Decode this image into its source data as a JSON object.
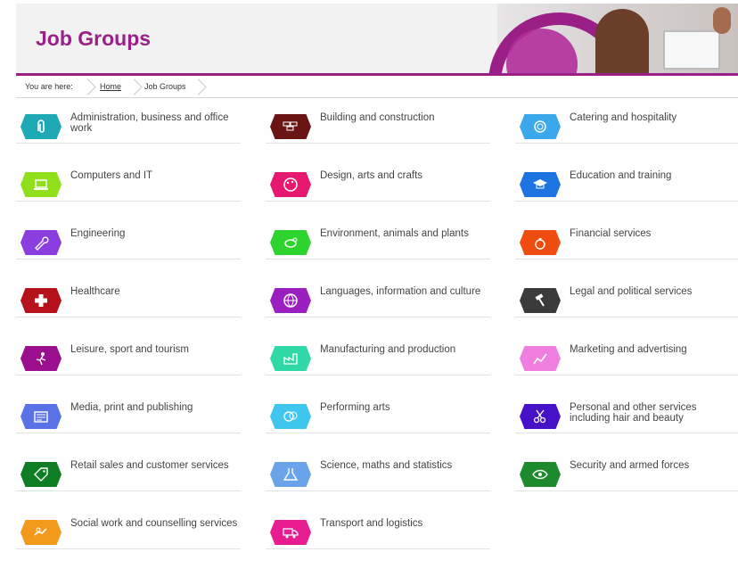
{
  "header": {
    "title": "Job Groups"
  },
  "breadcrumb": {
    "prefix": "You are here:",
    "home": "Home",
    "current": "Job Groups"
  },
  "groups": [
    {
      "label": "Administration, business and office work",
      "color": "#1ea9b4",
      "icon": "paperclip-icon"
    },
    {
      "label": "Building and construction",
      "color": "#6b1414",
      "icon": "bricks-icon"
    },
    {
      "label": "Catering and hospitality",
      "color": "#3aa8ea",
      "icon": "plate-icon"
    },
    {
      "label": "Computers and IT",
      "color": "#8fe01a",
      "icon": "laptop-icon"
    },
    {
      "label": "Design, arts and crafts",
      "color": "#e6186f",
      "icon": "palette-icon"
    },
    {
      "label": "Education and training",
      "color": "#1d74e0",
      "icon": "mortarboard-icon"
    },
    {
      "label": "Engineering",
      "color": "#8a3ee0",
      "icon": "wrench-icon"
    },
    {
      "label": "Environment, animals and plants",
      "color": "#2fd32f",
      "icon": "animal-icon"
    },
    {
      "label": "Financial services",
      "color": "#ef4d10",
      "icon": "money-bag-icon"
    },
    {
      "label": "Healthcare",
      "color": "#b5121b",
      "icon": "medical-cross-icon"
    },
    {
      "label": "Languages, information and culture",
      "color": "#9b1fc0",
      "icon": "globe-icon"
    },
    {
      "label": "Legal and political services",
      "color": "#3b3b3b",
      "icon": "gavel-icon"
    },
    {
      "label": "Leisure, sport and tourism",
      "color": "#9b0f8e",
      "icon": "person-icon"
    },
    {
      "label": "Manufacturing and production",
      "color": "#2fd8a6",
      "icon": "factory-icon"
    },
    {
      "label": "Marketing and advertising",
      "color": "#ee7fe0",
      "icon": "chart-icon"
    },
    {
      "label": "Media, print and publishing",
      "color": "#5a72e6",
      "icon": "newspaper-icon"
    },
    {
      "label": "Performing arts",
      "color": "#3fc6ef",
      "icon": "masks-icon"
    },
    {
      "label": "Personal and other services including hair and beauty",
      "color": "#4712c7",
      "icon": "scissors-icon"
    },
    {
      "label": "Retail sales and customer services",
      "color": "#0f7d24",
      "icon": "tag-icon"
    },
    {
      "label": "Science, maths and statistics",
      "color": "#6aa3ea",
      "icon": "flask-icon"
    },
    {
      "label": "Security and armed forces",
      "color": "#1e8a2e",
      "icon": "eye-icon"
    },
    {
      "label": "Social work and counselling services",
      "color": "#f29a1c",
      "icon": "hands-icon"
    },
    {
      "label": "Transport and logistics",
      "color": "#e81c91",
      "icon": "truck-icon"
    }
  ]
}
